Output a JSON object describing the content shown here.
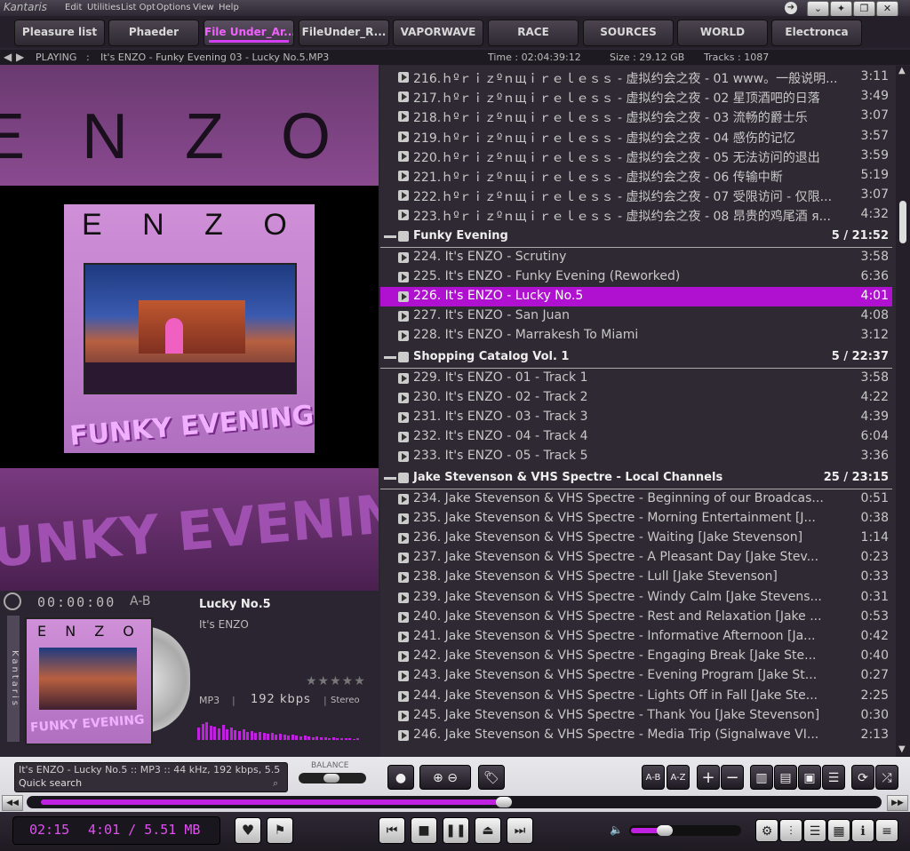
{
  "app": {
    "name": "Kantaris"
  },
  "menu": [
    "Edit",
    "Utilities",
    "List Opt",
    "Options",
    "View",
    "Help"
  ],
  "tabs": [
    "Pleasure list",
    "Phaeder",
    "File Under_Ar...",
    "FileUnder_R...",
    "VAPORWAVE",
    "RACE",
    "SOURCES",
    "WORLD",
    "Electronca"
  ],
  "active_tab_index": 2,
  "status": {
    "playing": "PLAYING",
    "track": "It's ENZO - Funky Evening 03 - Lucky No.5.MP3",
    "time": "Time : 02:04:39:12",
    "size": "Size : 29.12 GB",
    "tracks": "Tracks : 1087"
  },
  "art": {
    "banner_text": "E N Z O",
    "cover_text": "E N Z O",
    "cover_title": "FUNKY EVENING",
    "bottom_text": "UNKY EVENIN"
  },
  "now_playing": {
    "elapsed": "00:00:00",
    "ab": "A-B",
    "title": "Lucky No.5",
    "artist": "It's ENZO",
    "format": "MP3",
    "bitrate": "192 kbps",
    "channels": "Stereo",
    "side_text": "Kantaris",
    "rating": "★★★★★",
    "mini_cover_text": "E N Z O",
    "mini_cover_title": "FUNKY EVENING"
  },
  "playlist": [
    {
      "kind": "row",
      "t": "216.ｈºｒｉｚºｎщｉｒｅｌｅｓｓ - 虚拟约会之夜 - 01 www。一般说明...",
      "d": "3:11"
    },
    {
      "kind": "row",
      "t": "217.ｈºｒｉｚºｎщｉｒｅｌｅｓｓ - 虚拟约会之夜 - 02 星顶酒吧的日落",
      "d": "3:49"
    },
    {
      "kind": "row",
      "t": "218.ｈºｒｉｚºｎщｉｒｅｌｅｓｓ - 虚拟约会之夜 - 03 流畅的爵士乐",
      "d": "3:07"
    },
    {
      "kind": "row",
      "t": "219.ｈºｒｉｚºｎщｉｒｅｌｅｓｓ - 虚拟约会之夜 - 04 感伤的记忆",
      "d": "3:57"
    },
    {
      "kind": "row",
      "t": "220.ｈºｒｉｚºｎщｉｒｅｌｅｓｓ - 虚拟约会之夜 - 05 无法访问的退出",
      "d": "3:59"
    },
    {
      "kind": "row",
      "t": "221.ｈºｒｉｚºｎщｉｒｅｌｅｓｓ - 虚拟约会之夜 - 06 传输中断",
      "d": "5:19"
    },
    {
      "kind": "row",
      "t": "222.ｈºｒｉｚºｎщｉｒｅｌｅｓｓ - 虚拟约会之夜 - 07 受限访问 - 仅限...",
      "d": "3:07"
    },
    {
      "kind": "row",
      "t": "223.ｈºｒｉｚºｎщｉｒｅｌｅｓｓ - 虚拟约会之夜 - 08 昂贵的鸡尾酒 я...",
      "d": "4:32"
    },
    {
      "kind": "group",
      "t": "Funky Evening",
      "d": "5 / 21:52"
    },
    {
      "kind": "row",
      "t": "224. It's ENZO - Scrutiny",
      "d": "3:58"
    },
    {
      "kind": "row",
      "t": "225. It's ENZO - Funky Evening (Reworked)",
      "d": "6:36"
    },
    {
      "kind": "row",
      "t": "226. It's ENZO - Lucky No.5",
      "d": "4:01",
      "sel": true
    },
    {
      "kind": "row",
      "t": "227. It's ENZO - San Juan",
      "d": "4:08"
    },
    {
      "kind": "row",
      "t": "228. It's ENZO - Marrakesh To Miami",
      "d": "3:12"
    },
    {
      "kind": "group",
      "t": "Shopping Catalog Vol. 1",
      "d": "5 / 22:37"
    },
    {
      "kind": "row",
      "t": "229. It's ENZO - 01 - Track 1",
      "d": "3:58"
    },
    {
      "kind": "row",
      "t": "230. It's ENZO - 02 - Track 2",
      "d": "4:22"
    },
    {
      "kind": "row",
      "t": "231. It's ENZO - 03 - Track 3",
      "d": "4:39"
    },
    {
      "kind": "row",
      "t": "232. It's ENZO - 04 - Track 4",
      "d": "6:04"
    },
    {
      "kind": "row",
      "t": "233. It's ENZO - 05 - Track 5",
      "d": "3:36"
    },
    {
      "kind": "group",
      "t": "Jake Stevenson & VHS Spectre - Local Channels",
      "d": "25 / 23:15"
    },
    {
      "kind": "row",
      "t": "234. Jake Stevenson & VHS Spectre - Beginning of our Broadcas...",
      "d": "0:51"
    },
    {
      "kind": "row",
      "t": "235. Jake Stevenson & VHS Spectre - Morning Entertainment [J...",
      "d": "0:38"
    },
    {
      "kind": "row",
      "t": "236. Jake Stevenson & VHS Spectre - Waiting [Jake Stevenson]",
      "d": "1:14"
    },
    {
      "kind": "row",
      "t": "237. Jake Stevenson & VHS Spectre - A Pleasant Day [Jake Stev...",
      "d": "0:23"
    },
    {
      "kind": "row",
      "t": "238. Jake Stevenson & VHS Spectre - Lull [Jake Stevenson]",
      "d": "0:33"
    },
    {
      "kind": "row",
      "t": "239. Jake Stevenson & VHS Spectre - Windy Calm [Jake Stevens...",
      "d": "0:31"
    },
    {
      "kind": "row",
      "t": "240. Jake Stevenson & VHS Spectre - Rest and Relaxation [Jake ...",
      "d": "0:53"
    },
    {
      "kind": "row",
      "t": "241. Jake Stevenson & VHS Spectre - Informative Afternoon [Ja...",
      "d": "0:42"
    },
    {
      "kind": "row",
      "t": "242. Jake Stevenson & VHS Spectre - Engaging Break [Jake Ste...",
      "d": "0:40"
    },
    {
      "kind": "row",
      "t": "243. Jake Stevenson & VHS Spectre - Evening Program [Jake St...",
      "d": "0:27"
    },
    {
      "kind": "row",
      "t": "244. Jake Stevenson & VHS Spectre - Lights Off in Fall [Jake Ste...",
      "d": "2:25"
    },
    {
      "kind": "row",
      "t": "245. Jake Stevenson & VHS Spectre - Thank You [Jake Stevenson]",
      "d": "0:30"
    },
    {
      "kind": "row",
      "t": "246. Jake Stevenson & VHS Spectre - Media Trip (Signalwave VI...",
      "d": "2:13"
    }
  ],
  "controls": {
    "info_line": "It's ENZO - Lucky No.5 :: MP3 :: 44 kHz, 192 kbps, 5.5",
    "search_placeholder": "Quick search",
    "balance": "BALANCE",
    "ab_btn": "A-B",
    "az_btn": "A-Z",
    "plus": "+",
    "minus": "−",
    "time_now": "02:15",
    "time_total": "4:01 / 5.51 MB",
    "progress": 0.56,
    "volume": 0.3
  },
  "colors": {
    "accent": "#c020e0",
    "selected_row": "#b010d0"
  }
}
